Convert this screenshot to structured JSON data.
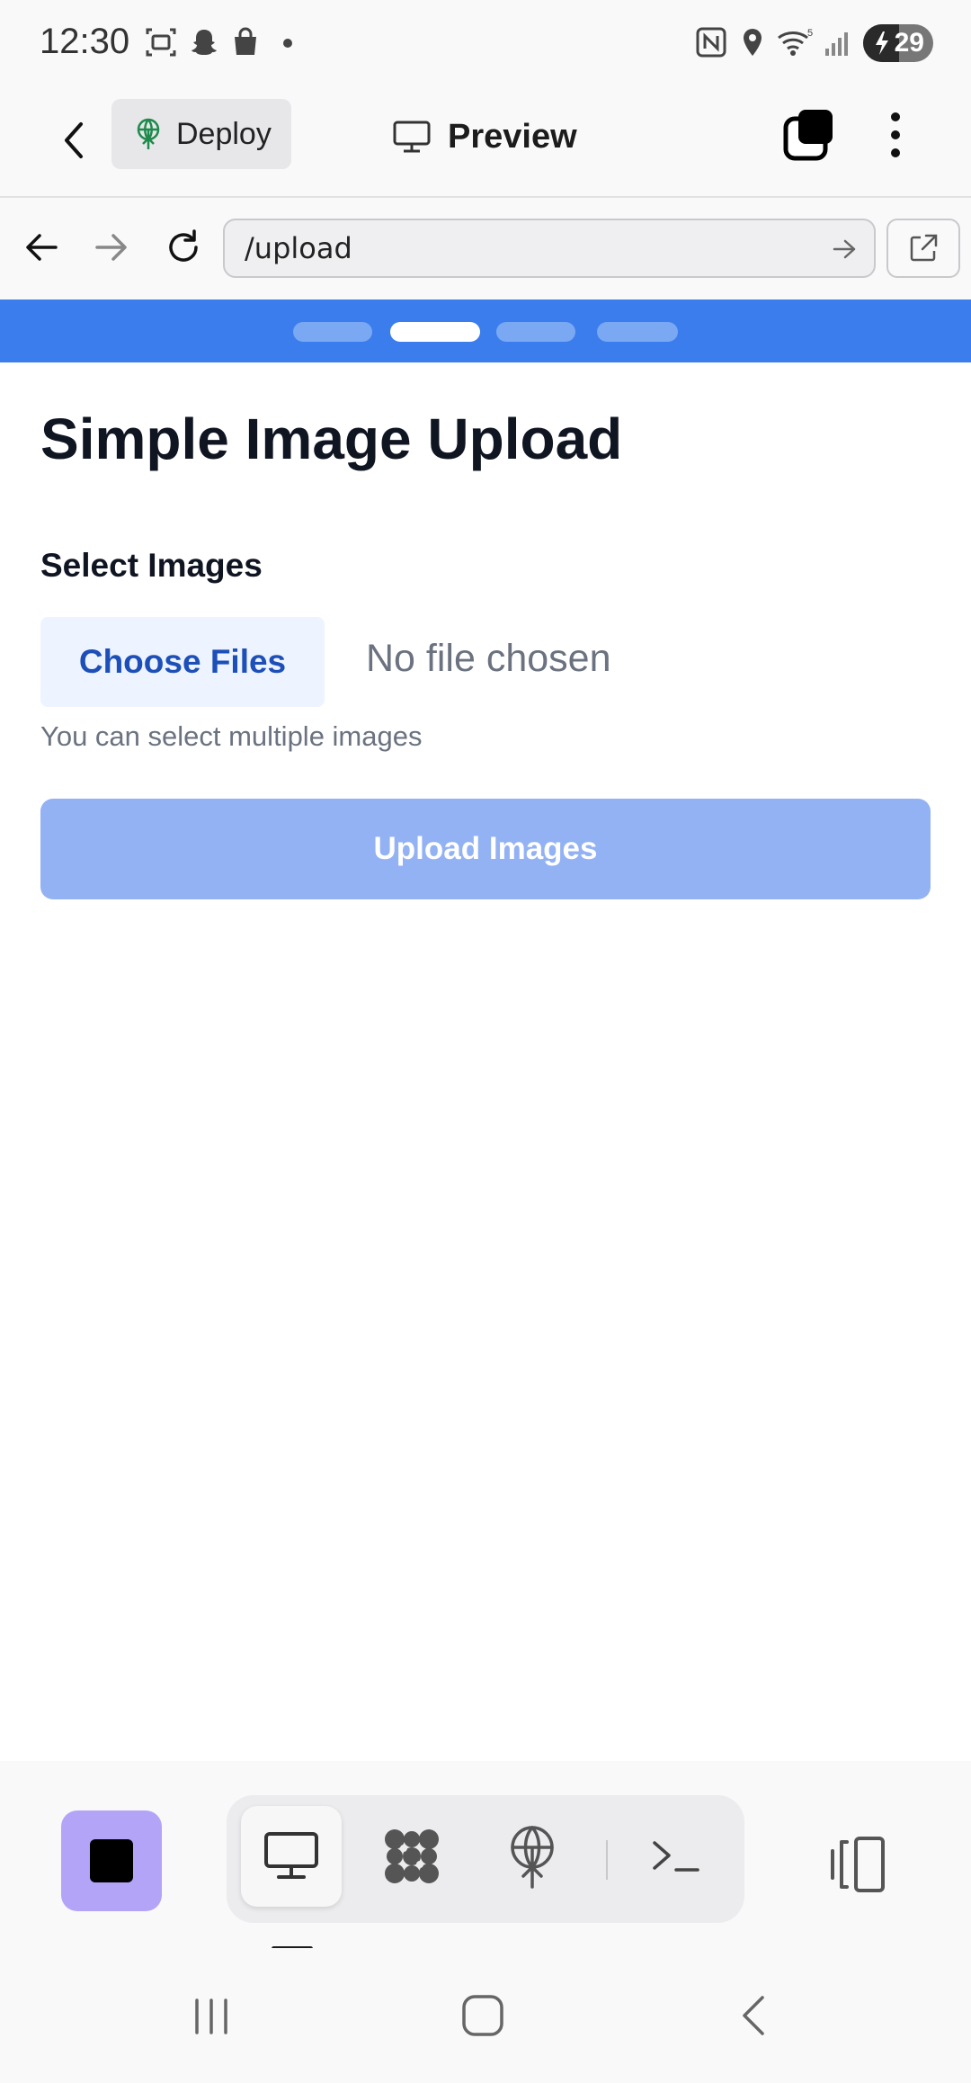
{
  "status_bar": {
    "time": "12:30",
    "battery": "29",
    "left_icons": [
      "screenshot-icon",
      "snapchat-icon",
      "shopping-bag-icon",
      "dot-icon"
    ],
    "right_icons": [
      "nfc-icon",
      "location-icon",
      "wifi-icon",
      "signal-icon"
    ]
  },
  "app_bar": {
    "deploy_label": "Deploy",
    "preview_label": "Preview"
  },
  "browser": {
    "url": "/upload"
  },
  "dev_strip": {
    "pills": 4,
    "active_index": 1
  },
  "page": {
    "title": "Simple Image Upload",
    "field_label": "Select Images",
    "choose_files_label": "Choose Files",
    "no_file_text": "No file chosen",
    "hint": "You can select multiple images",
    "upload_button": "Upload Images"
  },
  "toolbar": {
    "modes": [
      "desktop-icon",
      "apps-icon",
      "deploy-icon",
      "terminal-icon"
    ],
    "active_mode": "desktop-icon"
  },
  "colors": {
    "accent_blue": "#3b7ded",
    "upload_disabled": "#93b2f4",
    "stop_purple": "#b4a4f7",
    "choose_files_bg": "#eef4ff",
    "choose_files_text": "#1d4fb8"
  }
}
